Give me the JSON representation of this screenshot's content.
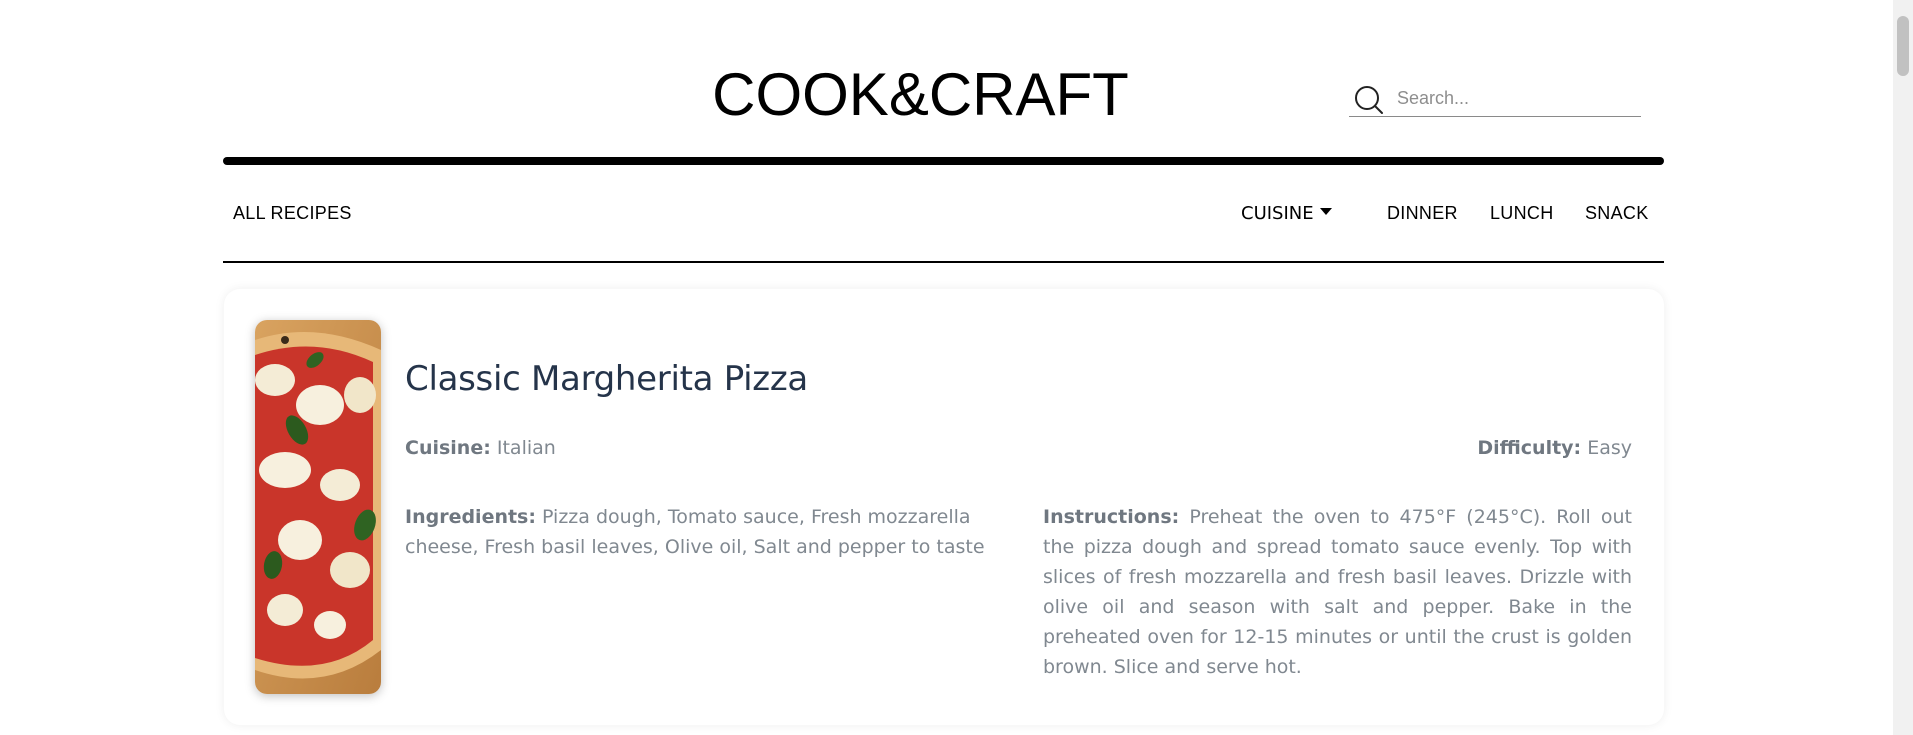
{
  "brand": {
    "logo": "COOK&CRAFT"
  },
  "search": {
    "placeholder": "Search...",
    "value": "",
    "icon": "search-icon"
  },
  "nav": {
    "all_recipes": "ALL RECIPES",
    "cuisine": "CUISINE",
    "items": [
      "DINNER",
      "LUNCH",
      "SNACK"
    ]
  },
  "recipe": {
    "title": "Classic Margherita Pizza",
    "image_alt": "pizza-image",
    "cuisine_label": "Cuisine:",
    "cuisine": "Italian",
    "difficulty_label": "Difficulty:",
    "difficulty": "Easy",
    "ingredients_label": "Ingredients:",
    "ingredients": "Pizza dough, Tomato sauce, Fresh mozzarella cheese, Fresh basil leaves, Olive oil, Salt and pepper to taste",
    "instructions_label": "Instructions:",
    "instructions": "Preheat the oven to 475°F (245°C). Roll out the pizza dough and spread tomato sauce evenly. Top with slices of fresh mozzarella and fresh basil leaves. Drizzle with olive oil and season with salt and pepper. Bake in the preheated oven for 12-15 minutes or until the crust is golden brown. Slice and serve hot."
  },
  "colors": {
    "title": "#25344a",
    "body_text": "#808890",
    "rule": "#000000"
  }
}
